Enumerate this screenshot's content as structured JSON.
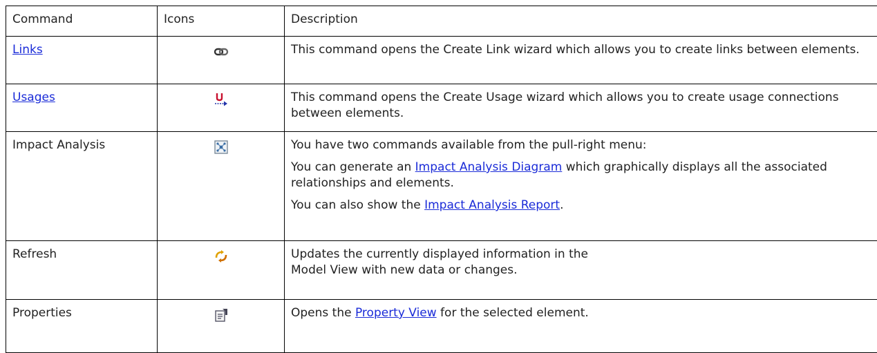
{
  "table": {
    "headers": [
      "Command",
      "Icons",
      "Description"
    ],
    "rows": [
      {
        "command": "Links",
        "icon": "link-chain-icon",
        "description": "This command opens the Create Link wizard which allows you to create links between elements."
      },
      {
        "command": "Usages",
        "icon": "usage-arrow-icon",
        "description": "This command opens the Create Usage wizard which allows you to create usage connections between elements."
      },
      {
        "command": "Impact Analysis",
        "icon": "impact-analysis-icon",
        "description_p1": "You have two commands available from the pull-right menu:",
        "description_p2_pre": "You can generate an ",
        "description_p2_link": "Impact Analysis Diagram",
        "description_p2_post": " which graphically displays all the associated relationships and elements.",
        "description_p3_pre": "You can also show the ",
        "description_p3_link": "Impact Analysis Report",
        "description_p3_post": "."
      },
      {
        "command": "Refresh",
        "icon": "refresh-icon",
        "description_line1": "Updates the currently displayed information in the",
        "description_line2": "Model View with new data or changes."
      },
      {
        "command": "Properties",
        "icon": "properties-icon",
        "description_pre": "Opens the ",
        "description_link": "Property View",
        "description_post": " for the selected element."
      }
    ]
  },
  "colors": {
    "link": "#1a2bd8",
    "border": "#000000",
    "text": "#222222"
  }
}
